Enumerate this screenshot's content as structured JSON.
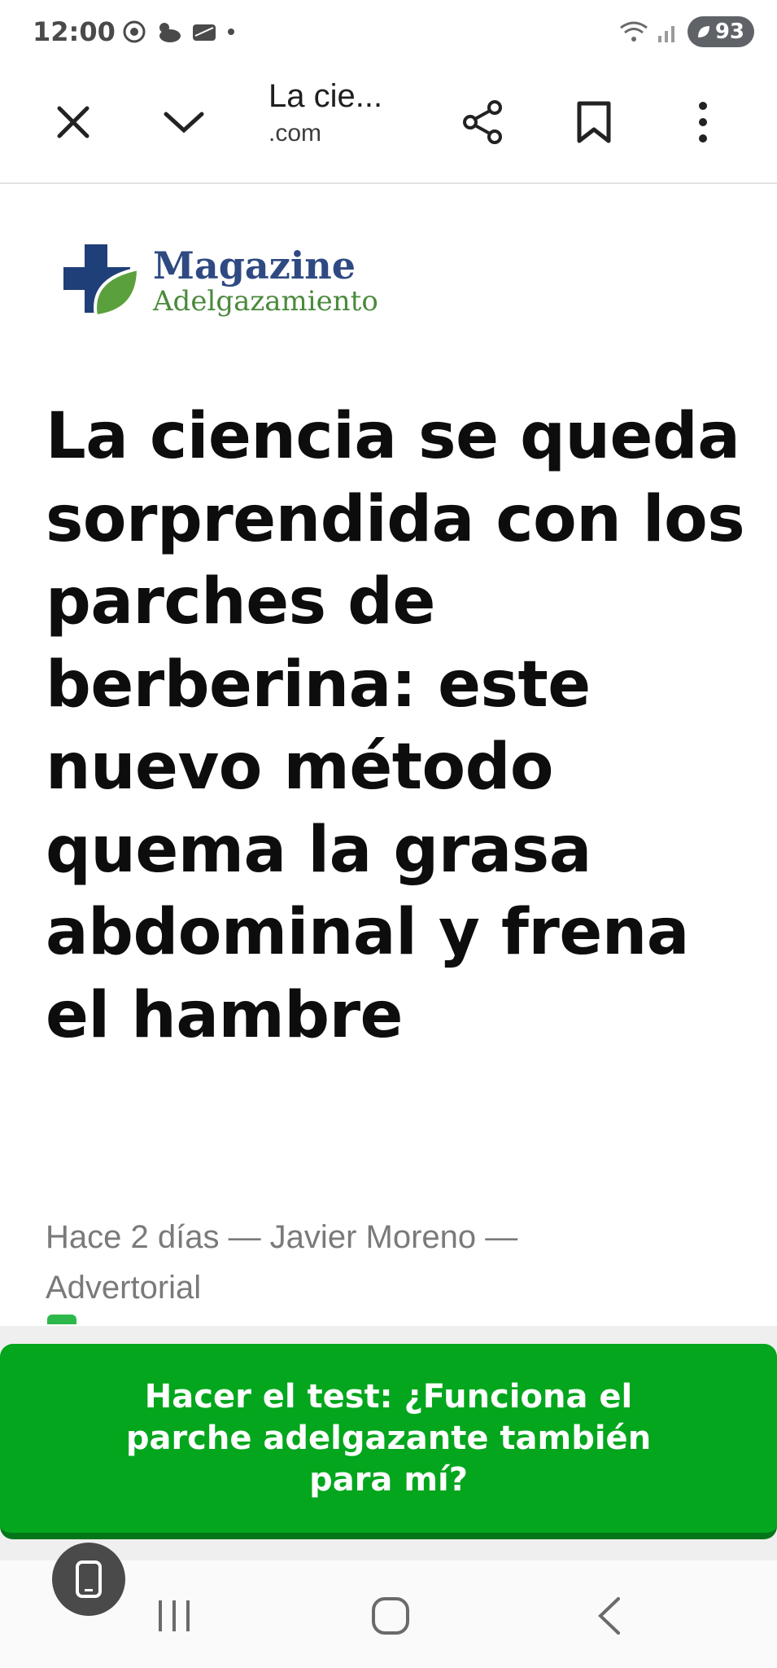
{
  "status": {
    "time": "12:00",
    "battery": "93"
  },
  "toolbar": {
    "title": "La cie...",
    "domain": ".com"
  },
  "logo": {
    "line1": "Magazine",
    "line2": "Adelgazamiento"
  },
  "article": {
    "headline": "La ciencia se queda sorprendida con los parches de berberina: este nuevo método quema la grasa abdominal y frena el hambre",
    "meta": "Hace 2 días — Javier Moreno — Advertorial"
  },
  "cta": {
    "label": "Hacer el test: ¿Funciona el parche adelgazante también para mí?",
    "color": "#03a61c"
  },
  "icons": {
    "close": "close-icon",
    "minimize": "chevron-down-icon",
    "share": "share-icon",
    "bookmark": "bookmark-icon",
    "menu": "more-vert-icon"
  }
}
